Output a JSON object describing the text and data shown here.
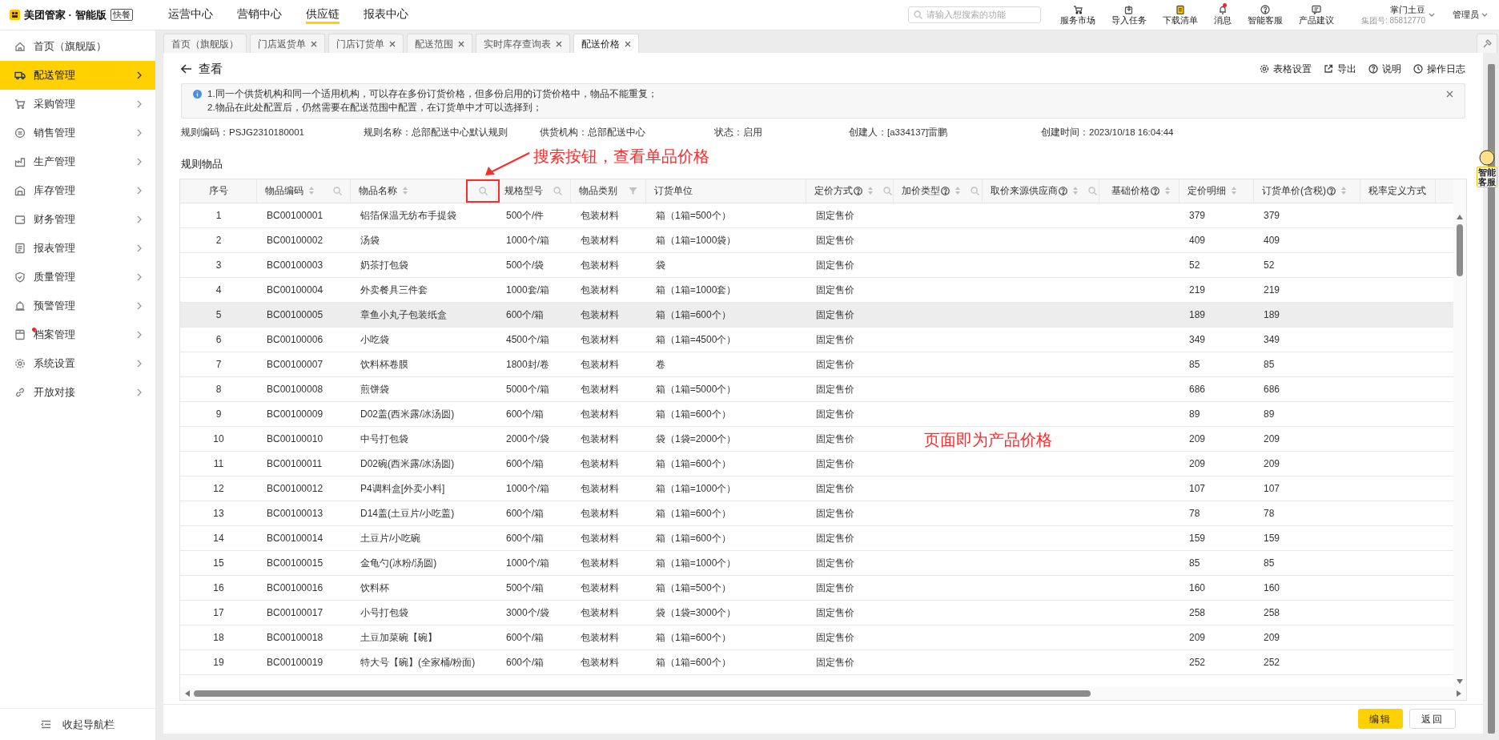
{
  "brand": {
    "name": "美团管家 · 智能版",
    "badge": "快餐"
  },
  "top_nav": [
    {
      "label": "运营中心",
      "selected": false
    },
    {
      "label": "营销中心",
      "selected": false
    },
    {
      "label": "供应链",
      "selected": true
    },
    {
      "label": "报表中心",
      "selected": false
    }
  ],
  "search": {
    "placeholder": "请输入想搜索的功能"
  },
  "top_actions": [
    {
      "label": "服务市场",
      "alert": false
    },
    {
      "label": "导入任务",
      "alert": false
    },
    {
      "label": "下载清单",
      "alert": false
    },
    {
      "label": "消息",
      "alert": true
    },
    {
      "label": "智能客服",
      "alert": false
    },
    {
      "label": "产品建议",
      "alert": false
    }
  ],
  "account": {
    "name": "掌门土豆",
    "group": "集团号: 85812770",
    "role": "管理员"
  },
  "sidebar": {
    "items": [
      {
        "label": "首页（旗舰版）",
        "selected": false,
        "expandable": false,
        "alert": false
      },
      {
        "label": "配送管理",
        "selected": true,
        "expandable": true,
        "alert": false
      },
      {
        "label": "采购管理",
        "selected": false,
        "expandable": true,
        "alert": false
      },
      {
        "label": "销售管理",
        "selected": false,
        "expandable": true,
        "alert": false
      },
      {
        "label": "生产管理",
        "selected": false,
        "expandable": true,
        "alert": false
      },
      {
        "label": "库存管理",
        "selected": false,
        "expandable": true,
        "alert": false
      },
      {
        "label": "财务管理",
        "selected": false,
        "expandable": true,
        "alert": false
      },
      {
        "label": "报表管理",
        "selected": false,
        "expandable": true,
        "alert": false
      },
      {
        "label": "质量管理",
        "selected": false,
        "expandable": true,
        "alert": false
      },
      {
        "label": "预警管理",
        "selected": false,
        "expandable": true,
        "alert": false
      },
      {
        "label": "档案管理",
        "selected": false,
        "expandable": true,
        "alert": true
      },
      {
        "label": "系统设置",
        "selected": false,
        "expandable": true,
        "alert": false
      },
      {
        "label": "开放对接",
        "selected": false,
        "expandable": true,
        "alert": false
      }
    ],
    "collapse": "收起导航栏"
  },
  "tabs": [
    {
      "label": "首页（旗舰版）",
      "selected": false,
      "closable": false
    },
    {
      "label": "门店返货单",
      "selected": false,
      "closable": true
    },
    {
      "label": "门店订货单",
      "selected": false,
      "closable": true
    },
    {
      "label": "配送范围",
      "selected": false,
      "closable": true
    },
    {
      "label": "实时库存查询表",
      "selected": false,
      "closable": true
    },
    {
      "label": "配送价格",
      "selected": true,
      "closable": true
    }
  ],
  "page": {
    "title": "查看",
    "toolbar": [
      "表格设置",
      "导出",
      "说明",
      "操作日志"
    ],
    "notice": [
      "1.同一个供货机构和同一个适用机构，可以存在多份订货价格，但多份启用的订货价格中，物品不能重复；",
      "2.物品在此处配置后，仍然需要在配送范围中配置，在订货单中才可以选择到；"
    ],
    "info": [
      "规则编码：PSJG2310180001",
      "规则名称：总部配送中心默认规则",
      "供货机构：总部配送中心",
      "状态：启用",
      "创建人：[a334137]雷鹏",
      "创建时间：2023/10/18 16:04:44"
    ],
    "section": "规则物品"
  },
  "table": {
    "columns": [
      {
        "label": "序号",
        "help": false,
        "sort": false,
        "search": false,
        "filter": false,
        "marked": false
      },
      {
        "label": "物品编码",
        "help": false,
        "sort": true,
        "search": true,
        "filter": false,
        "marked": false
      },
      {
        "label": "物品名称",
        "help": false,
        "sort": true,
        "search": true,
        "filter": false,
        "marked": true
      },
      {
        "label": "规格型号",
        "help": false,
        "sort": false,
        "search": true,
        "filter": false,
        "marked": false
      },
      {
        "label": "物品类别",
        "help": false,
        "sort": false,
        "search": false,
        "filter": true,
        "marked": false
      },
      {
        "label": "订货单位",
        "help": false,
        "sort": false,
        "search": false,
        "filter": false,
        "marked": false
      },
      {
        "label": "定价方式",
        "help": true,
        "sort": true,
        "search": true,
        "filter": false,
        "marked": false
      },
      {
        "label": "加价类型",
        "help": true,
        "sort": true,
        "search": true,
        "filter": false,
        "marked": false
      },
      {
        "label": "取价来源供应商",
        "help": true,
        "sort": true,
        "search": true,
        "filter": false,
        "marked": false
      },
      {
        "label": "基础价格",
        "help": true,
        "sort": true,
        "search": false,
        "filter": false,
        "marked": false
      },
      {
        "label": "定价明细",
        "help": false,
        "sort": true,
        "search": false,
        "filter": false,
        "marked": false
      },
      {
        "label": "订货单价(含税)",
        "help": true,
        "sort": true,
        "search": false,
        "filter": false,
        "marked": false
      },
      {
        "label": "税率定义方式",
        "help": false,
        "sort": false,
        "search": false,
        "filter": false,
        "marked": false
      }
    ],
    "rows": [
      {
        "highlighted": false,
        "cells": [
          "1",
          "BC00100001",
          "铝箔保温无纺布手提袋",
          "500个/件",
          "包装材料",
          "箱（1箱=500个）",
          "固定售价",
          "379",
          "379"
        ]
      },
      {
        "highlighted": false,
        "cells": [
          "2",
          "BC00100002",
          "汤袋",
          "1000个/箱",
          "包装材料",
          "箱（1箱=1000袋）",
          "固定售价",
          "409",
          "409"
        ]
      },
      {
        "highlighted": false,
        "cells": [
          "3",
          "BC00100003",
          "奶茶打包袋",
          "500个/袋",
          "包装材料",
          "袋",
          "固定售价",
          "52",
          "52"
        ]
      },
      {
        "highlighted": false,
        "cells": [
          "4",
          "BC00100004",
          "外卖餐具三件套",
          "1000套/箱",
          "包装材料",
          "箱（1箱=1000套）",
          "固定售价",
          "219",
          "219"
        ]
      },
      {
        "highlighted": true,
        "cells": [
          "5",
          "BC00100005",
          "章鱼小丸子包装纸盒",
          "600个/箱",
          "包装材料",
          "箱（1箱=600个）",
          "固定售价",
          "189",
          "189"
        ]
      },
      {
        "highlighted": false,
        "cells": [
          "6",
          "BC00100006",
          "小吃袋",
          "4500个/箱",
          "包装材料",
          "箱（1箱=4500个）",
          "固定售价",
          "349",
          "349"
        ]
      },
      {
        "highlighted": false,
        "cells": [
          "7",
          "BC00100007",
          "饮料杯卷膜",
          "1800封/卷",
          "包装材料",
          "卷",
          "固定售价",
          "85",
          "85"
        ]
      },
      {
        "highlighted": false,
        "cells": [
          "8",
          "BC00100008",
          "煎饼袋",
          "5000个/箱",
          "包装材料",
          "箱（1箱=5000个）",
          "固定售价",
          "686",
          "686"
        ]
      },
      {
        "highlighted": false,
        "cells": [
          "9",
          "BC00100009",
          "D02盖(西米露/冰汤圆)",
          "600个/箱",
          "包装材料",
          "箱（1箱=600个）",
          "固定售价",
          "89",
          "89"
        ]
      },
      {
        "highlighted": false,
        "cells": [
          "10",
          "BC00100010",
          "中号打包袋",
          "2000个/袋",
          "包装材料",
          "袋（1袋=2000个）",
          "固定售价",
          "209",
          "209"
        ]
      },
      {
        "highlighted": false,
        "cells": [
          "11",
          "BC00100011",
          "D02碗(西米露/冰汤圆)",
          "600个/箱",
          "包装材料",
          "箱（1箱=600个）",
          "固定售价",
          "209",
          "209"
        ]
      },
      {
        "highlighted": false,
        "cells": [
          "12",
          "BC00100012",
          "P4调料盒[外卖小料]",
          "1000个/箱",
          "包装材料",
          "箱（1箱=1000个）",
          "固定售价",
          "107",
          "107"
        ]
      },
      {
        "highlighted": false,
        "cells": [
          "13",
          "BC00100013",
          "D14盖(土豆片/小吃盖)",
          "600个/箱",
          "包装材料",
          "箱（1箱=600个）",
          "固定售价",
          "78",
          "78"
        ]
      },
      {
        "highlighted": false,
        "cells": [
          "14",
          "BC00100014",
          "土豆片/小吃碗",
          "600个/箱",
          "包装材料",
          "箱（1箱=600个）",
          "固定售价",
          "159",
          "159"
        ]
      },
      {
        "highlighted": false,
        "cells": [
          "15",
          "BC00100015",
          "金龟勺(冰粉/汤圆)",
          "1000个/箱",
          "包装材料",
          "箱（1箱=1000个）",
          "固定售价",
          "85",
          "85"
        ]
      },
      {
        "highlighted": false,
        "cells": [
          "16",
          "BC00100016",
          "饮料杯",
          "500个/箱",
          "包装材料",
          "箱（1箱=500个）",
          "固定售价",
          "160",
          "160"
        ]
      },
      {
        "highlighted": false,
        "cells": [
          "17",
          "BC00100017",
          "小号打包袋",
          "3000个/袋",
          "包装材料",
          "袋（1袋=3000个）",
          "固定售价",
          "258",
          "258"
        ]
      },
      {
        "highlighted": false,
        "cells": [
          "18",
          "BC00100018",
          "土豆加菜碗【碗】",
          "600个/箱",
          "包装材料",
          "箱（1箱=600个）",
          "固定售价",
          "209",
          "209"
        ]
      },
      {
        "highlighted": false,
        "cells": [
          "19",
          "BC00100019",
          "特大号【碗】(全家桶/粉面)",
          "600个/箱",
          "包装材料",
          "箱（1箱=600个）",
          "固定售价",
          "252",
          "252"
        ]
      }
    ]
  },
  "buttons": [
    {
      "label": "编辑",
      "primary": true
    },
    {
      "label": "返回",
      "primary": false
    }
  ],
  "assistant": {
    "label": "智能客服"
  },
  "annotations": [
    {
      "kind": "callout",
      "text": "搜索按钮，查看单品价格"
    },
    {
      "kind": "note",
      "text": "页面即为产品价格"
    }
  ]
}
